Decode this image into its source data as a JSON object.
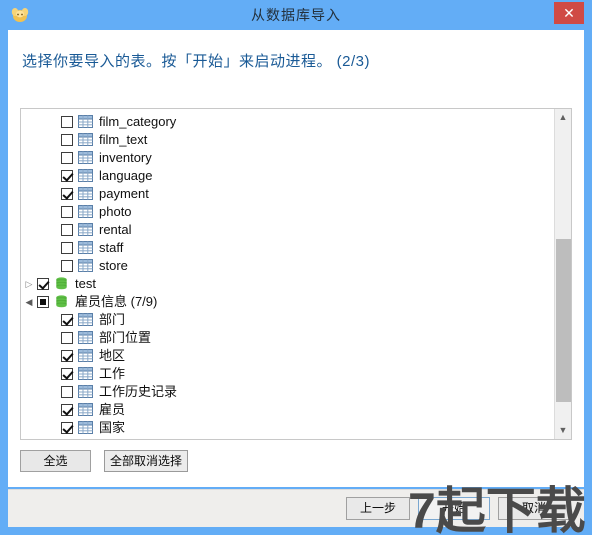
{
  "window": {
    "title": "从数据库导入",
    "icon": "elephant-icon",
    "close_label": "✕",
    "accent_color": "#63adf6",
    "close_color": "#d04a45"
  },
  "instruction": {
    "text": "选择你要导入的表。按「开始」来启动进程。  (2/3)",
    "color": "#1a5a96"
  },
  "list": {
    "rows": [
      {
        "label": "film_category",
        "indent": 2,
        "checked": "off",
        "icon": "table-icon",
        "expander": "none"
      },
      {
        "label": "film_text",
        "indent": 2,
        "checked": "off",
        "icon": "table-icon",
        "expander": "none"
      },
      {
        "label": "inventory",
        "indent": 2,
        "checked": "off",
        "icon": "table-icon",
        "expander": "none"
      },
      {
        "label": "language",
        "indent": 2,
        "checked": "on",
        "icon": "table-icon",
        "expander": "none"
      },
      {
        "label": "payment",
        "indent": 2,
        "checked": "on",
        "icon": "table-icon",
        "expander": "none"
      },
      {
        "label": "photo",
        "indent": 2,
        "checked": "off",
        "icon": "table-icon",
        "expander": "none"
      },
      {
        "label": "rental",
        "indent": 2,
        "checked": "off",
        "icon": "table-icon",
        "expander": "none"
      },
      {
        "label": "staff",
        "indent": 2,
        "checked": "off",
        "icon": "table-icon",
        "expander": "none"
      },
      {
        "label": "store",
        "indent": 2,
        "checked": "off",
        "icon": "table-icon",
        "expander": "none"
      },
      {
        "label": "test",
        "indent": 0,
        "checked": "on",
        "icon": "database-icon",
        "expander": "collapsed"
      },
      {
        "label": "雇员信息 (7/9)",
        "indent": 0,
        "checked": "partial",
        "icon": "database-icon",
        "expander": "expanded"
      },
      {
        "label": "部门",
        "indent": 2,
        "checked": "on",
        "icon": "table-icon",
        "expander": "none"
      },
      {
        "label": "部门位置",
        "indent": 2,
        "checked": "off",
        "icon": "table-icon",
        "expander": "none"
      },
      {
        "label": "地区",
        "indent": 2,
        "checked": "on",
        "icon": "table-icon",
        "expander": "none"
      },
      {
        "label": "工作",
        "indent": 2,
        "checked": "on",
        "icon": "table-icon",
        "expander": "none"
      },
      {
        "label": "工作历史记录",
        "indent": 2,
        "checked": "off",
        "icon": "table-icon",
        "expander": "none"
      },
      {
        "label": "雇员",
        "indent": 2,
        "checked": "on",
        "icon": "table-icon",
        "expander": "none"
      },
      {
        "label": "国家",
        "indent": 2,
        "checked": "on",
        "icon": "table-icon",
        "expander": "none"
      }
    ],
    "scrollbar": {
      "up_arrow": "▲",
      "down_arrow": "▼"
    }
  },
  "selection_buttons": {
    "select_all": "全选",
    "deselect_all": "全部取消选择"
  },
  "footer": {
    "previous": "上一步",
    "start": "开始",
    "cancel": "取消"
  },
  "watermark": {
    "text": "7起下载"
  }
}
